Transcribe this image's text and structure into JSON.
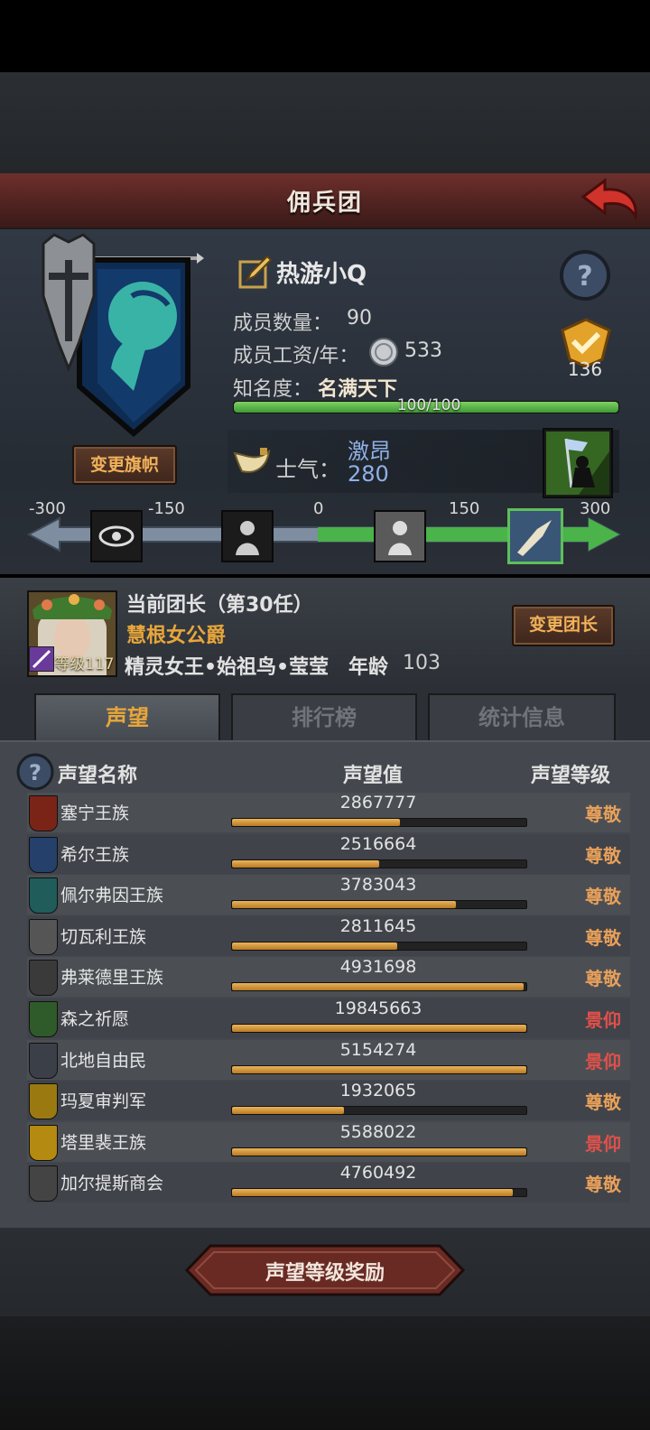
{
  "header": {
    "title": "佣兵团"
  },
  "guild": {
    "name": "热游小Q",
    "members_label": "成员数量：",
    "members": "90",
    "salary_label": "成员工资/年：",
    "salary": "533",
    "fame_label": "知名度：",
    "fame_value": "名满天下",
    "fame_progress_text": "100/100",
    "fame_progress": 1.0,
    "badge_count": "136",
    "change_banner": "变更旗帜",
    "morale_label": "士气：",
    "morale_state": "激昂",
    "morale_value": "280",
    "morale_scale": [
      "-300",
      "-150",
      "0",
      "150",
      "300"
    ]
  },
  "leader": {
    "title": "当前团长（第30任）",
    "name": "慧根女公爵",
    "level_label": "等级117",
    "race": "精灵女王•始祖鸟•莹莹",
    "age_label": "年龄",
    "age": "103",
    "change_button": "变更团长"
  },
  "tabs": [
    {
      "label": "声望",
      "active": true
    },
    {
      "label": "排行榜",
      "active": false
    },
    {
      "label": "统计信息",
      "active": false
    }
  ],
  "reputation": {
    "col_name": "声望名称",
    "col_value": "声望值",
    "col_level": "声望等级",
    "rows": [
      {
        "name": "塞宁王族",
        "value": "2867777",
        "progress": 0.57,
        "level": "尊敬",
        "level_color": "#e8a05a",
        "shield_color": "#7a2418"
      },
      {
        "name": "希尔王族",
        "value": "2516664",
        "progress": 0.5,
        "level": "尊敬",
        "level_color": "#e8a05a",
        "shield_color": "#24406b"
      },
      {
        "name": "佩尔弗因王族",
        "value": "3783043",
        "progress": 0.76,
        "level": "尊敬",
        "level_color": "#e8a05a",
        "shield_color": "#1f5c5a"
      },
      {
        "name": "切瓦利王族",
        "value": "2811645",
        "progress": 0.56,
        "level": "尊敬",
        "level_color": "#e8a05a",
        "shield_color": "#555555"
      },
      {
        "name": "弗莱德里王族",
        "value": "4931698",
        "progress": 0.99,
        "level": "尊敬",
        "level_color": "#e8a05a",
        "shield_color": "#3a3a3a"
      },
      {
        "name": "森之祈愿",
        "value": "19845663",
        "progress": 1.0,
        "level": "景仰",
        "level_color": "#e0504a",
        "shield_color": "#2f5a2a"
      },
      {
        "name": "北地自由民",
        "value": "5154274",
        "progress": 1.0,
        "level": "景仰",
        "level_color": "#e0504a",
        "shield_color": "#3b4048"
      },
      {
        "name": "玛夏审判军",
        "value": "1932065",
        "progress": 0.38,
        "level": "尊敬",
        "level_color": "#e8a05a",
        "shield_color": "#9a7a10"
      },
      {
        "name": "塔里裴王族",
        "value": "5588022",
        "progress": 1.0,
        "level": "景仰",
        "level_color": "#e0504a",
        "shield_color": "#b48a10"
      },
      {
        "name": "加尔提斯商会",
        "value": "4760492",
        "progress": 0.955,
        "level": "尊敬",
        "level_color": "#e8a05a",
        "shield_color": "#444444"
      }
    ]
  },
  "footer": {
    "reward_button": "声望等级奖励"
  },
  "colors": {
    "accent_orange": "#f2b25a",
    "progress_green": "#4fae47",
    "header_red": "#6e2f2b"
  },
  "icons": [
    "back-arrow-icon",
    "guild-banner-icon",
    "help-icon",
    "edit-icon",
    "silver-coin-icon",
    "badge-icon",
    "horn-icon",
    "morale-flag-icon",
    "eye-status-icon",
    "despair-status-icon",
    "calm-status-icon",
    "charge-status-icon",
    "leader-portrait-icon",
    "faction-shield-icon"
  ]
}
